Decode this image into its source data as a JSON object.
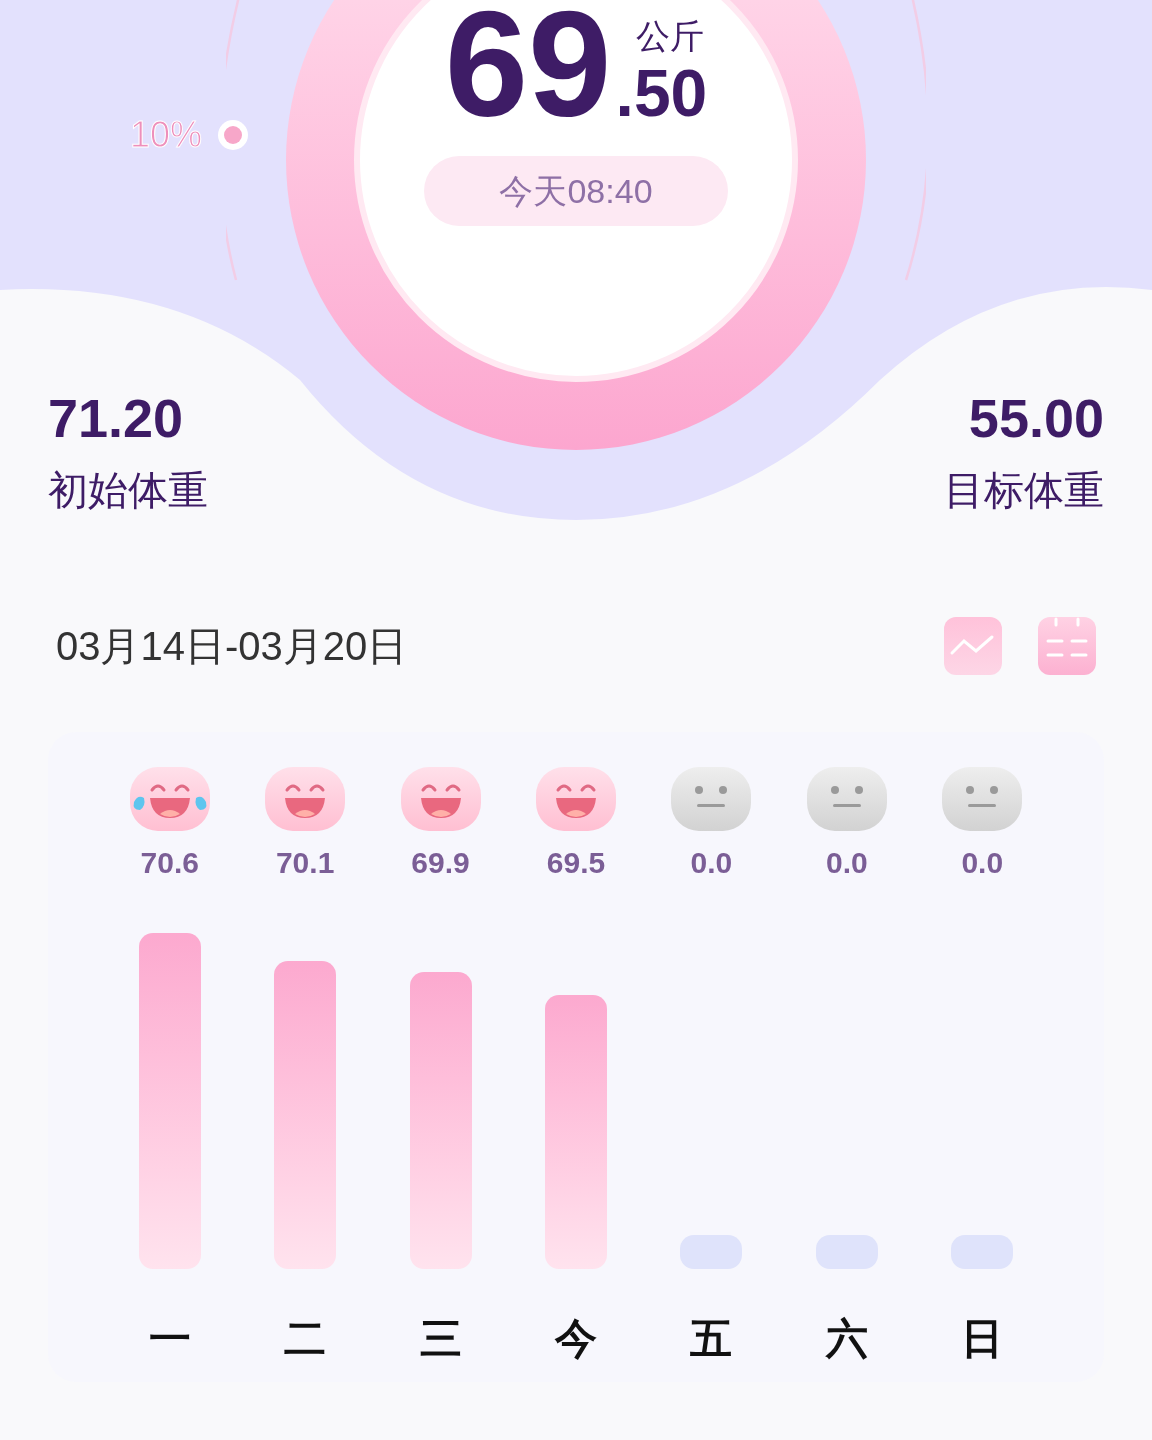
{
  "current": {
    "integer": "69",
    "decimal": ".50",
    "unit": "公斤",
    "time": "今天08:40",
    "progress_label": "10%"
  },
  "start": {
    "value": "71.20",
    "label": "初始体重"
  },
  "target": {
    "value": "55.00",
    "label": "目标体重"
  },
  "week": {
    "range": "03月14日-03月20日",
    "days": [
      {
        "kind": "laugh",
        "value": "70.6",
        "label": "一"
      },
      {
        "kind": "smile",
        "value": "70.1",
        "label": "二"
      },
      {
        "kind": "smile",
        "value": "69.9",
        "label": "三"
      },
      {
        "kind": "smile",
        "value": "69.5",
        "label": "今"
      },
      {
        "kind": "neutral",
        "value": "0.0",
        "label": "五"
      },
      {
        "kind": "neutral",
        "value": "0.0",
        "label": "六"
      },
      {
        "kind": "neutral",
        "value": "0.0",
        "label": "日"
      }
    ]
  }
}
